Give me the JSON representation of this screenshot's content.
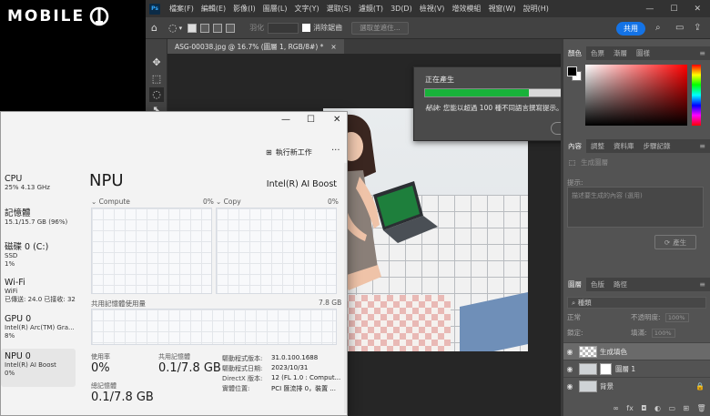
{
  "logo": {
    "text": "MOBILE"
  },
  "photoshop": {
    "menu": [
      "檔案(F)",
      "編輯(E)",
      "影像(I)",
      "圖層(L)",
      "文字(Y)",
      "選取(S)",
      "濾鏡(T)",
      "3D(D)",
      "檢視(V)",
      "增效模組",
      "視窗(W)",
      "說明(H)"
    ],
    "options": {
      "feather_label": "羽化",
      "antialias_label": "消除鋸齒",
      "select_subject_label": "選取並遮住...",
      "share_label": "共用"
    },
    "doc_tab": {
      "title": "ASG-00038.jpg @ 16.7% (圖層 1, RGB/8#) *",
      "close": "×"
    },
    "progress": {
      "title": "正在產生",
      "percent": 63,
      "tip_bold": "秘訣:",
      "tip_text": "您能以超過 100 種不同語言撰寫提示。",
      "cancel_label": "取消"
    },
    "panels": {
      "color_tabs": [
        "顏色",
        "色票",
        "漸層",
        "圖樣"
      ],
      "props_tabs": [
        "內容",
        "調整",
        "資料庫",
        "步驟記錄"
      ],
      "props_header": "生成圖層",
      "prompt_label": "提示:",
      "prompt_placeholder": "描述要生成的內容 (選用)",
      "generate_label": "產生",
      "layer_tabs": [
        "圖層",
        "色版",
        "路徑"
      ],
      "layer_filter": "種類",
      "blend_mode": "正常",
      "opacity_label": "不透明度:",
      "opacity_value": "100%",
      "lock_label": "鎖定:",
      "fill_label": "填滿:",
      "fill_value": "100%",
      "layers": [
        {
          "name": "生成填色",
          "selected": true
        },
        {
          "name": "圖層 1",
          "selected": false
        },
        {
          "name": "背景",
          "selected": false
        }
      ]
    }
  },
  "taskmanager": {
    "run_task_label": "執行新工作",
    "more_label": "···",
    "sidebar": [
      {
        "title": "CPU",
        "lines": [
          "25%  4.13 GHz"
        ]
      },
      {
        "title": "記憶體",
        "lines": [
          "15.1/15.7 GB (96%)"
        ]
      },
      {
        "title": "磁碟 0 (C:)",
        "lines": [
          "SSD",
          "1%"
        ]
      },
      {
        "title": "Wi-Fi",
        "lines": [
          "WiFi",
          "已傳送: 24.0  已接收: 32"
        ]
      },
      {
        "title": "GPU 0",
        "lines": [
          "Intel(R) Arc(TM) Gra...",
          "8%"
        ]
      },
      {
        "title": "NPU 0",
        "lines": [
          "Intel(R) AI Boost",
          "0%"
        ]
      }
    ],
    "npu": {
      "title": "NPU",
      "device": "Intel(R) AI Boost",
      "graph1_label": "Compute",
      "graph1_pct": "0%",
      "graph2_label": "Copy",
      "graph2_pct": "0%",
      "shared_mem_label": "共用記憶體使用量",
      "shared_mem_max": "7.8 GB",
      "utilization_label": "使用率",
      "utilization_value": "0%",
      "shared_label": "共用記憶體",
      "shared_value": "0.1/7.8 GB",
      "npu_mem_label": "總記憶體",
      "npu_mem_value": "0.1/7.8 GB",
      "details": [
        {
          "key": "驅動程式版本:",
          "value": "31.0.100.1688"
        },
        {
          "key": "驅動程式日期:",
          "value": "2023/10/31"
        },
        {
          "key": "DirectX 版本:",
          "value": "12 (FL 1.0 : Comput..."
        },
        {
          "key": "實體位置:",
          "value": "PCI 匯流排 0，裝置 ..."
        }
      ]
    }
  }
}
